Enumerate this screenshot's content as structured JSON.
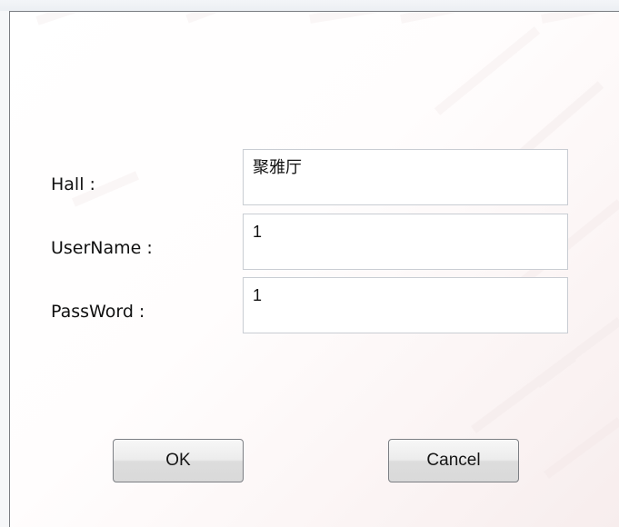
{
  "form": {
    "hall_label": "Hall :",
    "hall_value": "聚雅厅",
    "username_label": "UserName :",
    "username_value": "1",
    "password_label": "PassWord :",
    "password_value": "1"
  },
  "actions": {
    "ok_label": "OK",
    "cancel_label": "Cancel"
  }
}
